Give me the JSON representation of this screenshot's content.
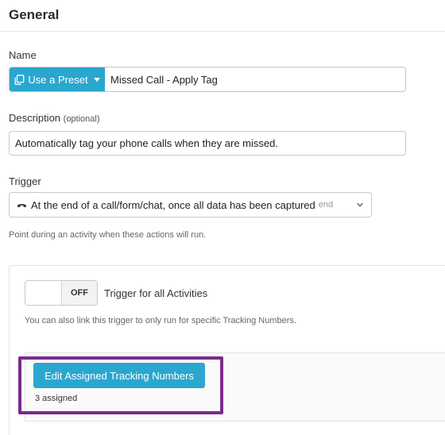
{
  "header": {
    "title": "General"
  },
  "name": {
    "label": "Name",
    "preset_button_label": "Use a Preset",
    "value": "Missed Call - Apply Tag"
  },
  "description": {
    "label": "Description",
    "optional_label": "(optional)",
    "value": "Automatically tag your phone calls when they are missed."
  },
  "trigger": {
    "label": "Trigger",
    "selected_value": "At the end of a call/form/chat, once all data has been captured",
    "selected_tag": "end",
    "help_text": "Point during an activity when these actions will run."
  },
  "activities_panel": {
    "toggle_state": "OFF",
    "toggle_label": "Trigger for all Activities",
    "help_text": "You can also link this trigger to only run for specific Tracking Numbers.",
    "edit_button_label": "Edit Assigned Tracking Numbers",
    "assigned_count_text": "3 assigned"
  },
  "colors": {
    "accent": "#2aa7cf",
    "highlight": "#7b2a8b"
  },
  "icons": {
    "preset": "copy-icon",
    "trigger": "phone-icon",
    "dropdown": "chevron-down-icon",
    "preset_dropdown": "caret-down-icon"
  }
}
